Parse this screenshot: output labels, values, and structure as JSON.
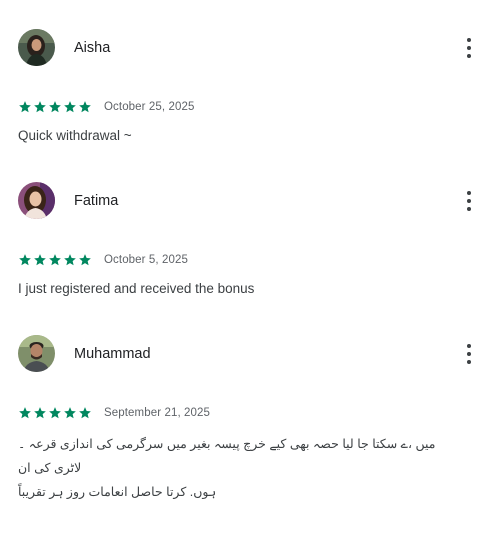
{
  "reviews": [
    {
      "name": "Aisha",
      "rating": 5,
      "max_rating": 5,
      "date": "October 25, 2025",
      "text": "Quick withdrawal ~",
      "avatar_icon": "user-photo-avatar"
    },
    {
      "name": "Fatima",
      "rating": 5,
      "max_rating": 5,
      "date": "October 5, 2025",
      "text": "I just registered and received the bonus",
      "avatar_icon": "user-photo-avatar"
    },
    {
      "name": "Muhammad",
      "rating": 5,
      "max_rating": 5,
      "date": "September 21, 2025",
      "text_line1": "میں ،ے سکتا جا لیا حصہ بھی کیے خرچ پیسہ بغیر میں سرگرمی کی اندازی قرعہ ۔ لاٹری کی ان",
      "text_line2": "ہوں. کرتا حاصل انعامات روز ہر تقریباً",
      "avatar_icon": "user-photo-avatar"
    }
  ],
  "colors": {
    "star": "#01875f",
    "name": "#202124",
    "date": "#5f6368",
    "text": "#3c4043"
  },
  "icons": {
    "menu": "more-vert-icon",
    "star": "star-filled-icon"
  }
}
